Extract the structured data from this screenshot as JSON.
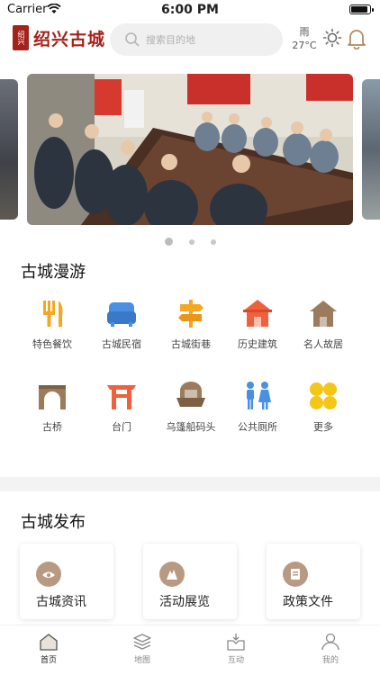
{
  "status_bar": {
    "carrier": "Carrier",
    "time": "6:00 PM",
    "battery_level": 0.9
  },
  "header": {
    "logo_seal_text": "绍兴",
    "logo_text": "绍兴古城",
    "search_placeholder": "搜索目的地",
    "weather_condition": "雨",
    "weather_temp": "27°C"
  },
  "carousel": {
    "slide_count": 3,
    "active_index": 0
  },
  "tour_section": {
    "title": "古城漫游",
    "items": [
      {
        "label": "特色餐饮",
        "icon": "utensils-icon",
        "color": "#f5a623"
      },
      {
        "label": "古城民宿",
        "icon": "bed-icon",
        "color": "#4a90e2"
      },
      {
        "label": "古城街巷",
        "icon": "signpost-icon",
        "color": "#f5a623"
      },
      {
        "label": "历史建筑",
        "icon": "building-icon",
        "color": "#f0603c"
      },
      {
        "label": "名人故居",
        "icon": "house-icon",
        "color": "#9b7b5b"
      },
      {
        "label": "古桥",
        "icon": "bridge-icon",
        "color": "#9b7b5b"
      },
      {
        "label": "台门",
        "icon": "gate-icon",
        "color": "#f0603c"
      },
      {
        "label": "乌篷船码头",
        "icon": "boat-icon",
        "color": "#9b7b5b"
      },
      {
        "label": "公共厕所",
        "icon": "restroom-icon",
        "color": "#4a90e2"
      },
      {
        "label": "更多",
        "icon": "more-icon",
        "color": "#f5c518"
      }
    ]
  },
  "publish_section": {
    "title": "古城发布",
    "cards": [
      {
        "label": "古城资讯",
        "icon": "eye-icon"
      },
      {
        "label": "活动展览",
        "icon": "exhibition-icon"
      },
      {
        "label": "政策文件",
        "icon": "document-icon"
      }
    ]
  },
  "tabbar": {
    "tabs": [
      {
        "label": "首页",
        "icon": "home-icon",
        "active": true
      },
      {
        "label": "地图",
        "icon": "map-icon",
        "active": false
      },
      {
        "label": "互动",
        "icon": "interact-icon",
        "active": false
      },
      {
        "label": "我的",
        "icon": "profile-icon",
        "active": false
      }
    ]
  }
}
